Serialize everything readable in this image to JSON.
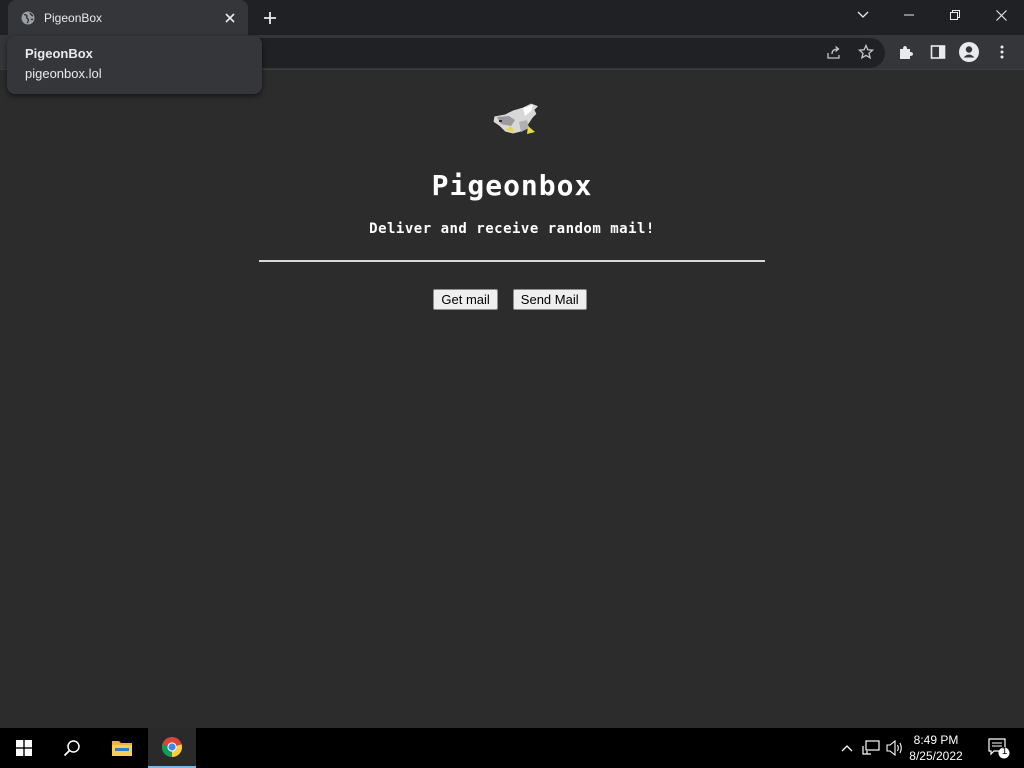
{
  "browser": {
    "tab_title": "PigeonBox",
    "hovercard": {
      "title": "PigeonBox",
      "url": "pigeonbox.lol"
    }
  },
  "page": {
    "title": "Pigeonbox",
    "subtitle": "Deliver and receive random mail!",
    "buttons": {
      "get_mail": "Get mail",
      "send_mail": "Send Mail"
    }
  },
  "taskbar": {
    "time": "8:49 PM",
    "date": "8/25/2022",
    "notification_count": "1"
  },
  "icons": {
    "tab_favicon": "globe-icon",
    "tab_close": "close-icon",
    "new_tab": "plus-icon",
    "tab_search": "chevron-down-icon",
    "share": "share-icon",
    "bookmark": "star-icon",
    "extensions": "puzzle-icon",
    "side_panel": "side-panel-icon",
    "profile": "person-icon",
    "menu": "kebab-menu-icon",
    "logo": "pigeon-icon"
  },
  "colors": {
    "page_background": "#2d2c2c",
    "chrome_dark": "#202124",
    "chrome_tab": "#35363a",
    "text_light": "#e8eaed"
  }
}
